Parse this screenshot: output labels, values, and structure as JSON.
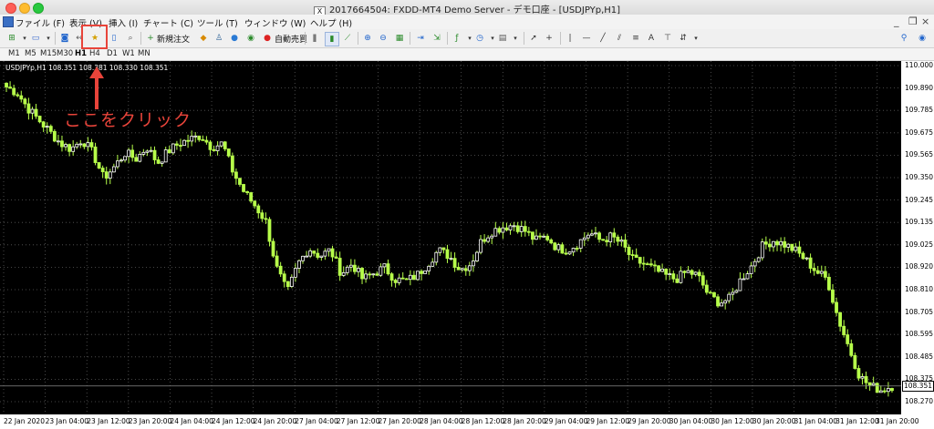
{
  "window": {
    "title": "2017664504: FXDD-MT4 Demo Server - デモ口座 - [USDJPYp,H1]",
    "title_icon": "X"
  },
  "menu": [
    {
      "label": "ファイル (F)"
    },
    {
      "label": "表示 (V)"
    },
    {
      "label": "挿入 (I)"
    },
    {
      "label": "チャート (C)"
    },
    {
      "label": "ツール (T)"
    },
    {
      "label": "ウィンドウ (W)"
    },
    {
      "label": "ヘルプ (H)"
    }
  ],
  "toolbar": {
    "new_order_label": "新規注文",
    "auto_trade_label": "自動売買",
    "text_tool_label": "A",
    "icons": [
      "new-chart-icon",
      "profiles-icon",
      "market-watch-icon",
      "data-window-icon",
      "navigator-icon",
      "terminal-icon",
      "tester-icon",
      "new-order-icon",
      "meta-editor-icon",
      "signals-icon",
      "auto-trading-icon",
      "bar-chart-icon",
      "candlestick-icon",
      "line-chart-icon",
      "zoom-in-icon",
      "zoom-out-icon",
      "tile-windows-icon",
      "chart-shift-icon",
      "autoscroll-icon",
      "indicators-icon",
      "periods-icon",
      "templates-icon",
      "cursor-icon",
      "crosshair-icon",
      "vertical-line-icon",
      "horizontal-line-icon",
      "trendline-icon",
      "channel-icon",
      "fibonacci-icon",
      "text-icon",
      "text-label-icon",
      "arrows-icon",
      "search-icon"
    ]
  },
  "timeframes": [
    "M1",
    "M5",
    "M15",
    "M30",
    "H1",
    "H4",
    "D1",
    "W1",
    "MN"
  ],
  "active_timeframe": "H1",
  "chart_info": "USDJPYp,H1  108.351 108.381 108.330 108.351",
  "current_price": "108.351",
  "annotation": "ここをクリック",
  "colors": {
    "chart_bg": "#000000",
    "bull": "#ffffff",
    "bear": "#b7ff4a",
    "grid": "#5a5a5a",
    "accent": "#e8443a"
  },
  "chart_data": {
    "type": "candlestick",
    "symbol": "USDJPYp",
    "timeframe": "H1",
    "ylim": [
      108.27,
      110.0
    ],
    "y_ticks": [
      "110.000",
      "109.890",
      "109.785",
      "109.675",
      "109.565",
      "109.350",
      "109.245",
      "109.135",
      "109.025",
      "108.920",
      "108.810",
      "108.705",
      "108.595",
      "108.485",
      "108.375",
      "108.270"
    ],
    "x_ticks": [
      "22 Jan 2020",
      "23 Jan 04:00",
      "23 Jan 12:00",
      "23 Jan 20:00",
      "24 Jan 04:00",
      "24 Jan 12:00",
      "24 Jan 20:00",
      "27 Jan 04:00",
      "27 Jan 12:00",
      "27 Jan 20:00",
      "28 Jan 04:00",
      "28 Jan 12:00",
      "28 Jan 20:00",
      "29 Jan 04:00",
      "29 Jan 12:00",
      "29 Jan 20:00",
      "30 Jan 04:00",
      "30 Jan 12:00",
      "30 Jan 20:00",
      "31 Jan 04:00",
      "31 Jan 12:00",
      "31 Jan 20:00"
    ],
    "close_path": [
      109.89,
      109.86,
      109.78,
      109.72,
      109.66,
      109.6,
      109.57,
      109.62,
      109.55,
      109.42,
      109.48,
      109.55,
      109.52,
      109.58,
      109.5,
      109.56,
      109.6,
      109.62,
      109.64,
      109.58,
      109.6,
      109.45,
      109.35,
      109.28,
      109.2,
      108.96,
      108.83,
      108.98,
      109.06,
      109.02,
      109.05,
      108.93,
      108.98,
      108.9,
      108.93,
      108.96,
      108.9,
      108.89,
      108.92,
      108.98,
      109.05,
      109.02,
      108.95,
      108.98,
      109.1,
      109.15,
      109.17,
      109.18,
      109.15,
      109.1,
      109.12,
      109.06,
      109.05,
      109.09,
      109.14,
      109.1,
      109.12,
      109.08,
      109.0,
      108.98,
      108.95,
      108.92,
      108.9,
      108.94,
      108.92,
      108.82,
      108.78,
      108.8,
      108.9,
      108.97,
      109.07,
      109.1,
      109.08,
      109.05,
      109.0,
      108.94,
      108.9,
      108.7,
      108.55,
      108.4,
      108.35,
      108.33,
      108.351
    ]
  }
}
